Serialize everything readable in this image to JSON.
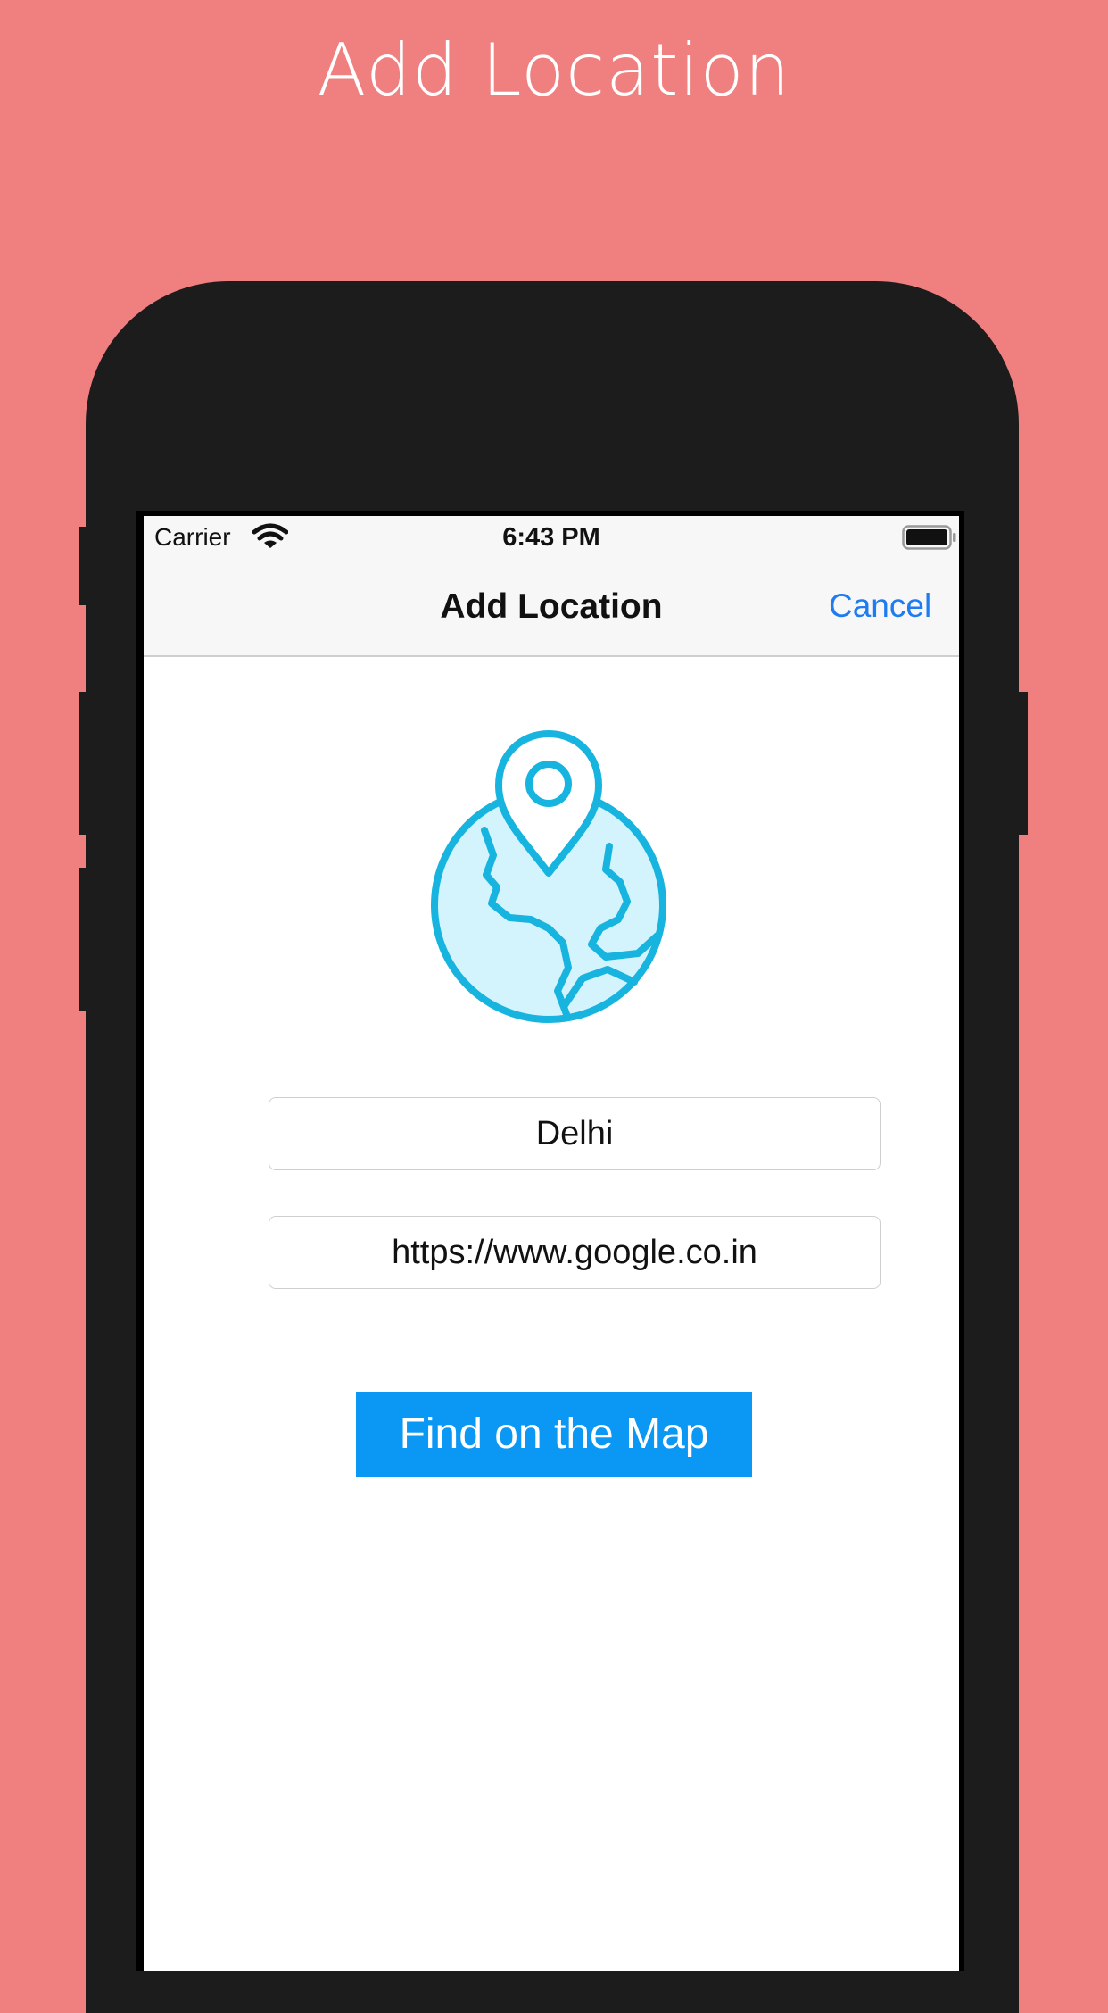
{
  "caption": "Add Location",
  "status_bar": {
    "carrier": "Carrier",
    "time": "6:43 PM"
  },
  "navbar": {
    "title": "Add Location",
    "cancel_label": "Cancel"
  },
  "form": {
    "location_value": "Delhi",
    "url_value": "https://www.google.co.in",
    "submit_label": "Find on the Map"
  },
  "icons": {
    "wifi": "wifi-icon",
    "battery": "battery-icon",
    "globe": "globe-location-icon"
  },
  "colors": {
    "background": "#F07F7F",
    "accent": "#1E7CF0",
    "button": "#0B97F4",
    "globe_stroke": "#16B4DE",
    "globe_fill": "#D3F3FD"
  }
}
